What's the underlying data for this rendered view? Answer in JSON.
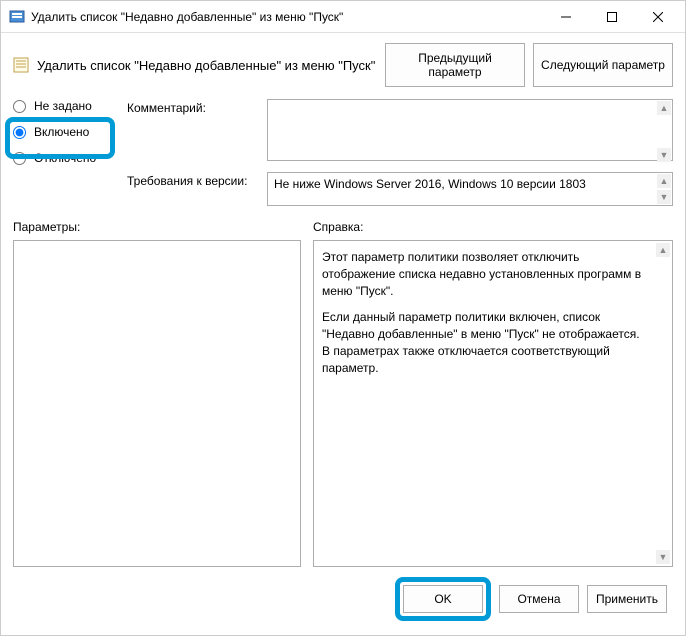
{
  "window": {
    "title": "Удалить список \"Недавно добавленные\" из меню \"Пуск\""
  },
  "header": {
    "title": "Удалить список \"Недавно добавленные\" из меню \"Пуск\"",
    "prev_btn": "Предыдущий параметр",
    "next_btn": "Следующий параметр"
  },
  "state": {
    "not_configured_label": "Не задано",
    "enabled_label": "Включено",
    "disabled_label": "Отключено",
    "selected": "enabled"
  },
  "fields": {
    "comment_label": "Комментарий:",
    "comment_value": "",
    "version_label": "Требования к версии:",
    "version_value": "Не ниже Windows Server 2016, Windows 10 версии 1803"
  },
  "panels": {
    "params_label": "Параметры:",
    "help_label": "Справка:",
    "help_p1": "Этот параметр политики позволяет отключить отображение списка недавно установленных программ в меню \"Пуск\".",
    "help_p2": "Если данный параметр политики включен, список \"Недавно добавленные\" в меню \"Пуск\" не отображается.  В параметрах также отключается соответствующий параметр."
  },
  "footer": {
    "ok": "OK",
    "cancel": "Отмена",
    "apply": "Применить"
  }
}
